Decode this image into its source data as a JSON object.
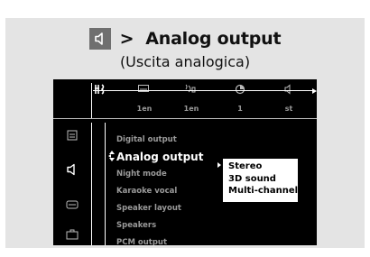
{
  "heading": {
    "icon": "speaker-icon",
    "arrow": ">",
    "title": "Analog output",
    "subtitle": "(Uscita analogica)"
  },
  "topbar": {
    "icons": [
      "settings-icon",
      "subtitle-icon",
      "audio-icon",
      "angle-icon",
      "speaker-icon"
    ],
    "values": [
      "1en",
      "1en",
      "1",
      "st"
    ]
  },
  "sidebar": {
    "icons": [
      "document-icon",
      "speaker-icon",
      "subtitle-icon",
      "briefcase-icon"
    ]
  },
  "menu": {
    "items": [
      "Digital output",
      "Analog output",
      "Night mode",
      "Karaoke vocal",
      "Speaker layout",
      "Speakers",
      "PCM output"
    ],
    "selected": "Analog output"
  },
  "popup": {
    "options": [
      "Stereo",
      "3D sound",
      "Multi-channel"
    ],
    "selected": "Stereo"
  },
  "colors": {
    "frame_bg": "#e4e4e4",
    "screen_bg": "#000000",
    "dim_text": "#9a9a9a",
    "highlight": "#ffffff"
  }
}
